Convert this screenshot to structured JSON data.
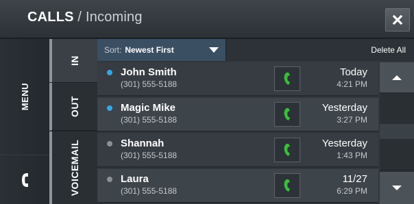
{
  "header": {
    "title_main": "CALLS",
    "title_separator": " / ",
    "title_sub": "Incoming",
    "close_icon": "close-x-icon"
  },
  "leftbar": {
    "menu_label": "MENU",
    "phone_icon": "phone-handset-icon"
  },
  "tabs": [
    {
      "label": "IN",
      "active": true
    },
    {
      "label": "OUT",
      "active": false
    },
    {
      "label": "VOICEMAIL",
      "active": false
    }
  ],
  "sort": {
    "label": "Sort:",
    "value": "Newest First"
  },
  "delete_all_label": "Delete All",
  "colors": {
    "unread_dot": "#33a8e6",
    "read_dot": "#8a9096",
    "call_icon": "#3bbf3b",
    "sort_bg": "#3b4f63"
  },
  "calls": [
    {
      "name": "John Smith",
      "number": "(301) 555-5188",
      "date": "Today",
      "time": "4:21 PM",
      "unread": true
    },
    {
      "name": "Magic Mike",
      "number": "(301) 555-5188",
      "date": "Yesterday",
      "time": "3:27 PM",
      "unread": true
    },
    {
      "name": "Shannah",
      "number": "(301) 555-5188",
      "date": "Yesterday",
      "time": "1:43 PM",
      "unread": false
    },
    {
      "name": "Laura",
      "number": "(301) 555-5188",
      "date": "11/27",
      "time": "6:29 PM",
      "unread": false
    }
  ]
}
